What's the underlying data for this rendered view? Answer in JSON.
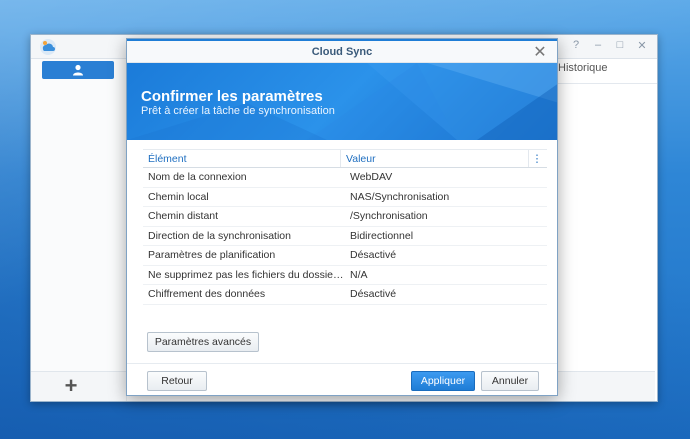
{
  "app": {
    "tab_historique": "Historique",
    "add_symbol": "+"
  },
  "dialog": {
    "title": "Cloud Sync",
    "close_symbol": "✕",
    "banner_title": "Confirmer les paramètres",
    "banner_subtitle": "Prêt à créer la tâche de synchronisation",
    "table": {
      "headers": [
        "Élément",
        "Valeur",
        "⋮"
      ],
      "rows": [
        [
          "Nom de la connexion",
          "WebDAV"
        ],
        [
          "Chemin local",
          "NAS/Synchronisation"
        ],
        [
          "Chemin distant",
          "/Synchronisation"
        ],
        [
          "Direction de la synchronisation",
          "Bidirectionnel"
        ],
        [
          "Paramètres de planification",
          "Désactivé"
        ],
        [
          "Ne supprimez pas les fichiers du dossier ...",
          "N/A"
        ],
        [
          "Chiffrement des données",
          "Désactivé"
        ]
      ]
    },
    "buttons": {
      "advanced": "Paramètres avancés",
      "back": "Retour",
      "apply": "Appliquer",
      "cancel": "Annuler"
    }
  },
  "colors": {
    "accent": "#1f7dd6",
    "banner": "#1b7bd9",
    "header_text": "#1f6fc0"
  }
}
